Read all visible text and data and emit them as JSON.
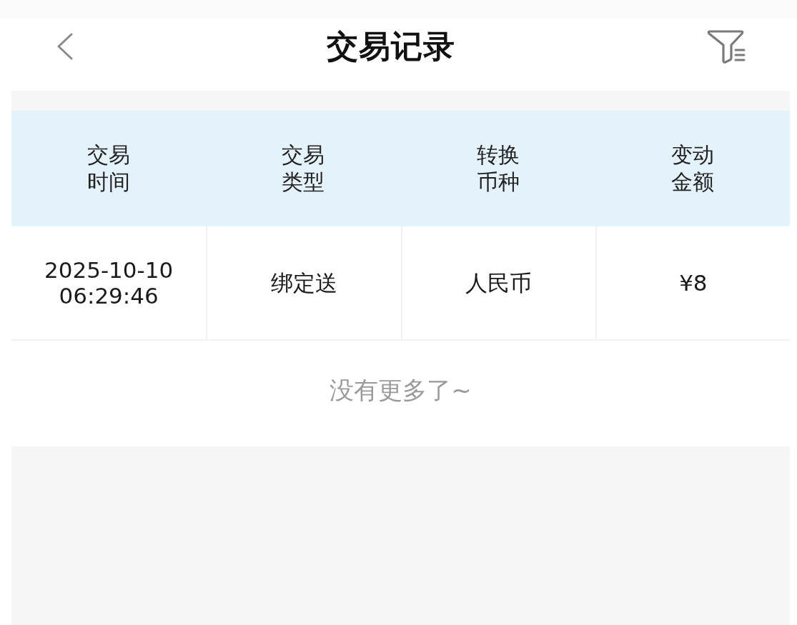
{
  "header": {
    "title": "交易记录"
  },
  "table": {
    "columns": [
      "交易时间",
      "交易类型",
      "转换币种",
      "变动金额"
    ],
    "rows": [
      [
        "2025-10-10\n06:29:46",
        "绑定送",
        "人民币",
        "¥8"
      ]
    ]
  },
  "footer": {
    "text": "没有更多了~"
  }
}
